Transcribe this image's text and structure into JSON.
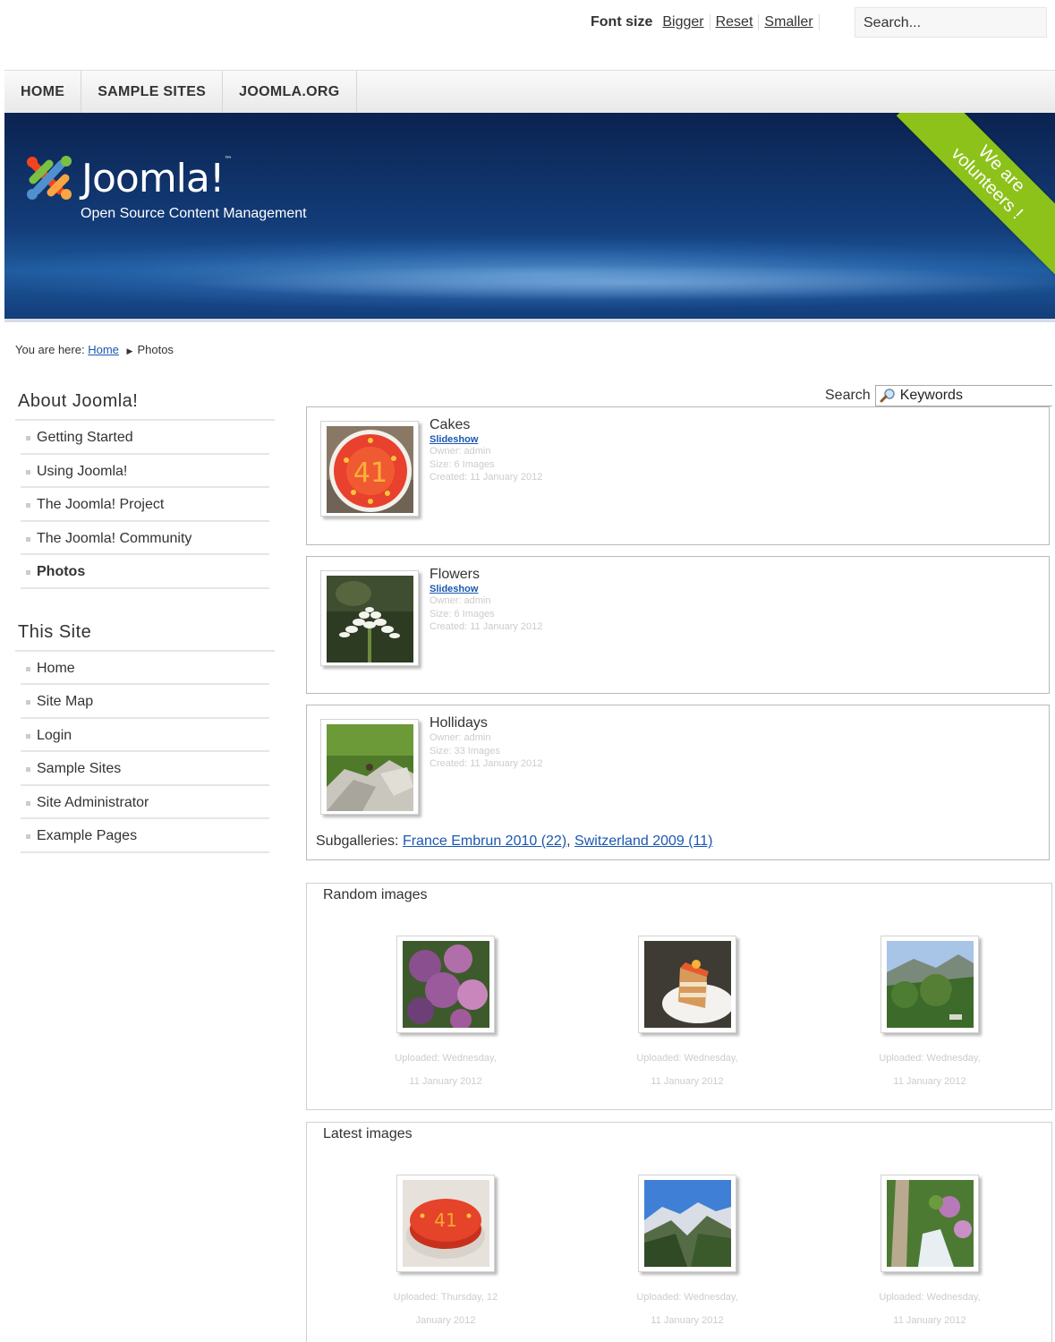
{
  "topbar": {
    "font_size_label": "Font size",
    "bigger": "Bigger",
    "reset": "Reset",
    "smaller": "Smaller",
    "search_placeholder": "Search..."
  },
  "nav": {
    "items": [
      "HOME",
      "SAMPLE SITES",
      "JOOMLA.ORG"
    ]
  },
  "header": {
    "logo_text": "Joomla!",
    "logo_tm": "™",
    "tagline": "Open Source Content Management",
    "ribbon_line1": "We are",
    "ribbon_line2": "volunteers !"
  },
  "breadcrumb": {
    "prefix": "You are here:",
    "home": "Home",
    "current": "Photos"
  },
  "sidebar": {
    "about_title": "About Joomla!",
    "about_items": [
      "Getting Started",
      "Using Joomla!",
      "The Joomla! Project",
      "The Joomla! Community",
      "Photos"
    ],
    "site_title": "This Site",
    "site_items": [
      "Home",
      "Site Map",
      "Login",
      "Sample Sites",
      "Site Administrator",
      "Example Pages"
    ]
  },
  "search": {
    "label": "Search",
    "placeholder": "Keywords"
  },
  "galleries": [
    {
      "name": "Cakes",
      "slideshow": "Slideshow",
      "owner": "Owner: admin",
      "size": "Size: 6 Images",
      "created": "Created: 11 January 2012"
    },
    {
      "name": "Flowers",
      "slideshow": "Slideshow",
      "owner": "Owner: admin",
      "size": "Size: 6 Images",
      "created": "Created: 11 January 2012"
    },
    {
      "name": "Hollidays",
      "owner": "Owner: admin",
      "size": "Size: 33 Images",
      "created": "Created: 11 January 2012",
      "subgalleries_label": "Subgalleries:",
      "sub1": "France Embrun 2010 (22)",
      "sub2": "Switzerland 2009 (11)"
    }
  ],
  "random_images": {
    "title": "Random images",
    "items": [
      {
        "line1": "Uploaded: Wednesday,",
        "line2": "11 January 2012"
      },
      {
        "line1": "Uploaded: Wednesday,",
        "line2": "11 January 2012"
      },
      {
        "line1": "Uploaded: Wednesday,",
        "line2": "11 January 2012"
      }
    ]
  },
  "latest_images": {
    "title": "Latest images",
    "items": [
      {
        "line1": "Uploaded: Thursday, 12",
        "line2": "January 2012"
      },
      {
        "line1": "Uploaded: Wednesday,",
        "line2": "11 January 2012"
      },
      {
        "line1": "Uploaded: Wednesday,",
        "line2": "11 January 2012"
      }
    ]
  },
  "colors": {
    "link": "#1b57b1",
    "header_dark": "#0b2350",
    "ribbon_green": "#8cc21a"
  }
}
